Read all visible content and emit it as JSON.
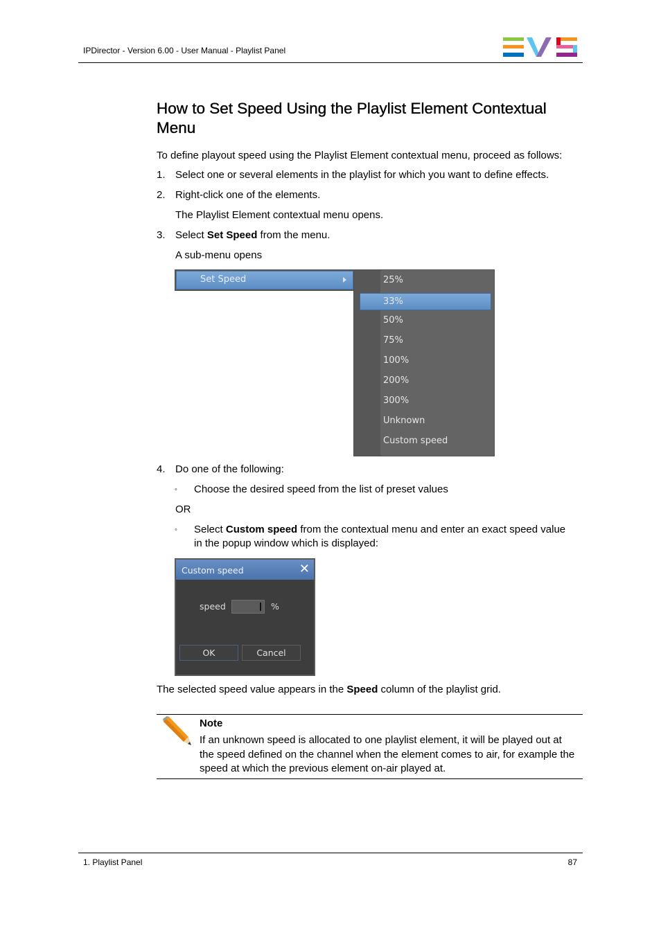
{
  "header": {
    "title": "IPDirector - Version 6.00 - User Manual - Playlist Panel",
    "logo": {
      "name": "EVS",
      "colors": {
        "green": "#8dc63f",
        "orange": "#f7941d",
        "blue": "#0072bc",
        "light_blue": "#5bc4f1",
        "purple": "#8e6bb0",
        "red": "#e2001a",
        "pink": "#e8609a",
        "magenta": "#92278f"
      }
    }
  },
  "section": {
    "title": "How to Set Speed Using the Playlist Element Contextual Menu",
    "intro": "To define playout speed using the Playlist Element contextual menu, proceed as follows:",
    "steps": [
      {
        "num": "1.",
        "text": "Select one or several elements in the playlist for which you want to define effects."
      },
      {
        "num": "2.",
        "text": "Right-click one of the elements.",
        "result": "The Playlist Element contextual menu opens."
      },
      {
        "num": "3.",
        "pre": "Select ",
        "bold": "Set Speed",
        "post": " from the menu.",
        "result": "A sub-menu opens"
      },
      {
        "num": "4.",
        "text": "Do one of the following:",
        "options": [
          {
            "bullet": "◦",
            "text": "Choose the desired speed from the list of preset values"
          },
          {
            "bullet": "◦",
            "pre": "Select ",
            "bold": "Custom speed",
            "post": " from the contextual menu and enter an exact speed value",
            "post2": "in the popup window which is displayed:"
          }
        ],
        "or": "OR"
      }
    ],
    "closing": {
      "pre": "The selected speed value appears in the ",
      "bold": "Speed",
      "post": " column of the playlist grid."
    }
  },
  "context_menu": {
    "main_item": "Set Speed",
    "submenu_items": [
      "25%",
      "33%",
      "50%",
      "75%",
      "100%",
      "200%",
      "300%",
      "Unknown",
      "Custom speed"
    ],
    "selected": "33%"
  },
  "custom_speed_dialog": {
    "title": "Custom speed",
    "field_label": "speed",
    "field_value": "",
    "unit": "%",
    "ok": "OK",
    "cancel": "Cancel"
  },
  "note": {
    "title": "Note",
    "lines": [
      "If an unknown speed is allocated to one playlist element, it will be played out at",
      "the speed defined on the channel when the element comes to air, for example the",
      "speed at which the previous element on-air played at."
    ]
  },
  "footer": {
    "chapter": "1. Playlist Panel",
    "page": "87"
  }
}
